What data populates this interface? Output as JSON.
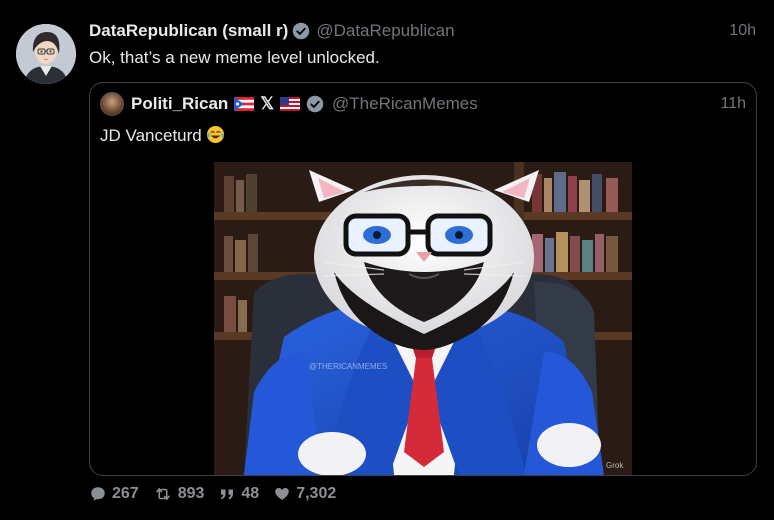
{
  "tweet": {
    "display_name": "DataRepublican (small r)",
    "handle": "@DataRepublican",
    "time": "10h",
    "text": "Ok, that’s a new meme level unlocked.",
    "avatar_icon": "anime-avatar-icon"
  },
  "quote": {
    "display_name": "Politi_Rican",
    "name_badges": [
      "puerto-rico-flag-icon",
      "x-logo-icon",
      "us-flag-icon",
      "verified-icon"
    ],
    "x_logo": "𝕏",
    "handle": "@TheRicanMemes",
    "time": "11h",
    "text": "JD Vanceturd",
    "emoji": "laughing-tears-emoji",
    "image_watermark": "@THERICANMEMES",
    "image_corner_mark": "Grok"
  },
  "actions": {
    "replies": "267",
    "reposts": "893",
    "quotes": "48",
    "likes": "7,302"
  },
  "colors": {
    "background": "#000000",
    "text": "#e7e9ea",
    "muted": "#71767b",
    "border": "#3d4146",
    "verified": "#8b98a5",
    "blazer": "#1f4fc9",
    "tie": "#d42a3a"
  }
}
